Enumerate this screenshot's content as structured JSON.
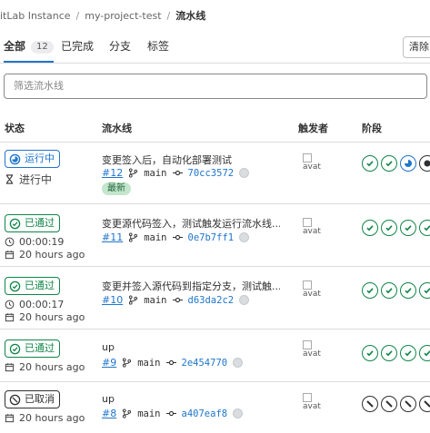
{
  "breadcrumb": {
    "group": "itLab Instance",
    "project": "my-project-test",
    "current": "流水线"
  },
  "tabs": [
    {
      "label": "全部",
      "count": "12"
    },
    {
      "label": "已完成"
    },
    {
      "label": "分支"
    },
    {
      "label": "标签"
    }
  ],
  "right_button": "清除",
  "filter": {
    "placeholder": "筛选流水线"
  },
  "table": {
    "headers": {
      "status": "状态",
      "pipeline": "流水线",
      "triggerer": "触发者",
      "stages": "阶段"
    },
    "avatar_alt": "avat"
  },
  "rows": [
    {
      "status": "运行中",
      "status_kind": "running",
      "progress_text": "进行中",
      "title": "变更签入后，自动化部署测试",
      "id": "#12",
      "ref": "main",
      "sha": "70cc3572",
      "latest": "最新",
      "stages": [
        "success",
        "success",
        "running",
        "pending"
      ]
    },
    {
      "status": "已通过",
      "status_kind": "passed",
      "duration": "00:00:19",
      "finished": "20 hours ago",
      "title": "变更源代码签入，测试触发运行流水线...",
      "id": "#11",
      "ref": "main",
      "sha": "0e7b7ff1",
      "stages": [
        "success",
        "success",
        "success",
        "success"
      ]
    },
    {
      "status": "已通过",
      "status_kind": "passed",
      "duration": "00:00:17",
      "finished": "20 hours ago",
      "title": "变更并签入源代码到指定分支，测试触...",
      "id": "#10",
      "ref": "main",
      "sha": "d63da2c2",
      "stages": [
        "success",
        "success",
        "success",
        "success"
      ]
    },
    {
      "status": "已通过",
      "status_kind": "passed",
      "finished": "20 hours ago",
      "title": "up",
      "id": "#9",
      "ref": "main",
      "sha": "2e454770",
      "stages": [
        "success",
        "success",
        "success",
        "success"
      ]
    },
    {
      "status": "已取消",
      "status_kind": "canceled",
      "finished": "20 hours ago",
      "title": "up",
      "id": "#8",
      "ref": "main",
      "sha": "a407eaf8",
      "stages": [
        "canceled",
        "canceled",
        "canceled",
        "canceled"
      ]
    }
  ]
}
